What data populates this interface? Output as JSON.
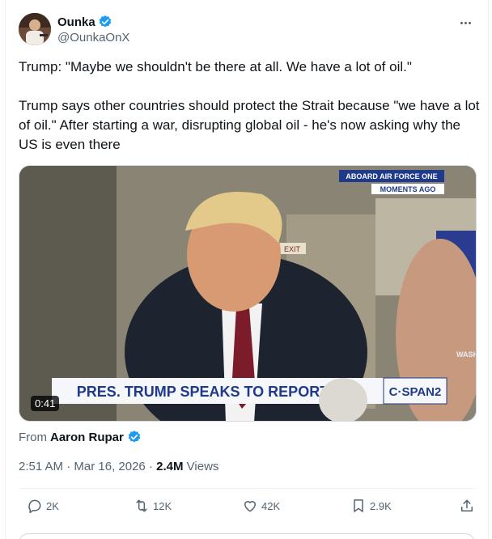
{
  "post": {
    "author": {
      "display_name": "Ounka",
      "handle": "@OunkaOnX",
      "verified_icon": "verified-badge-icon"
    },
    "text": "Trump: \"Maybe we shouldn't be there at all. We have a lot of oil.\"\n\nTrump says other countries should protect the Strait because \"we have a lot of oil.\" After starting a war, disrupting global oil - he's now asking why the US is even there",
    "media": {
      "overlay_top_line1": "ABOARD AIR FORCE ONE",
      "overlay_top_line2": "MOMENTS AGO",
      "chyron": "PRES. TRUMP SPEAKS TO REPORTERS",
      "network": "C·SPAN2",
      "exit_sign": "EXIT",
      "side_text": "WASHIN",
      "duration": "0:41"
    },
    "source": {
      "prefix": "From",
      "name": "Aaron Rupar"
    },
    "meta": {
      "time": "2:51 AM",
      "dot1": "·",
      "date": "Mar 16, 2026",
      "dot2": "·",
      "views_count": "2.4M",
      "views_label": "Views"
    },
    "actions": {
      "replies": "2K",
      "reposts": "12K",
      "likes": "42K",
      "bookmarks": "2.9K"
    }
  },
  "colors": {
    "accent": "#1d9bf0",
    "muted": "#536471",
    "chyron_bg": "#f5f7fb",
    "chyron_text": "#1f3a8a"
  }
}
